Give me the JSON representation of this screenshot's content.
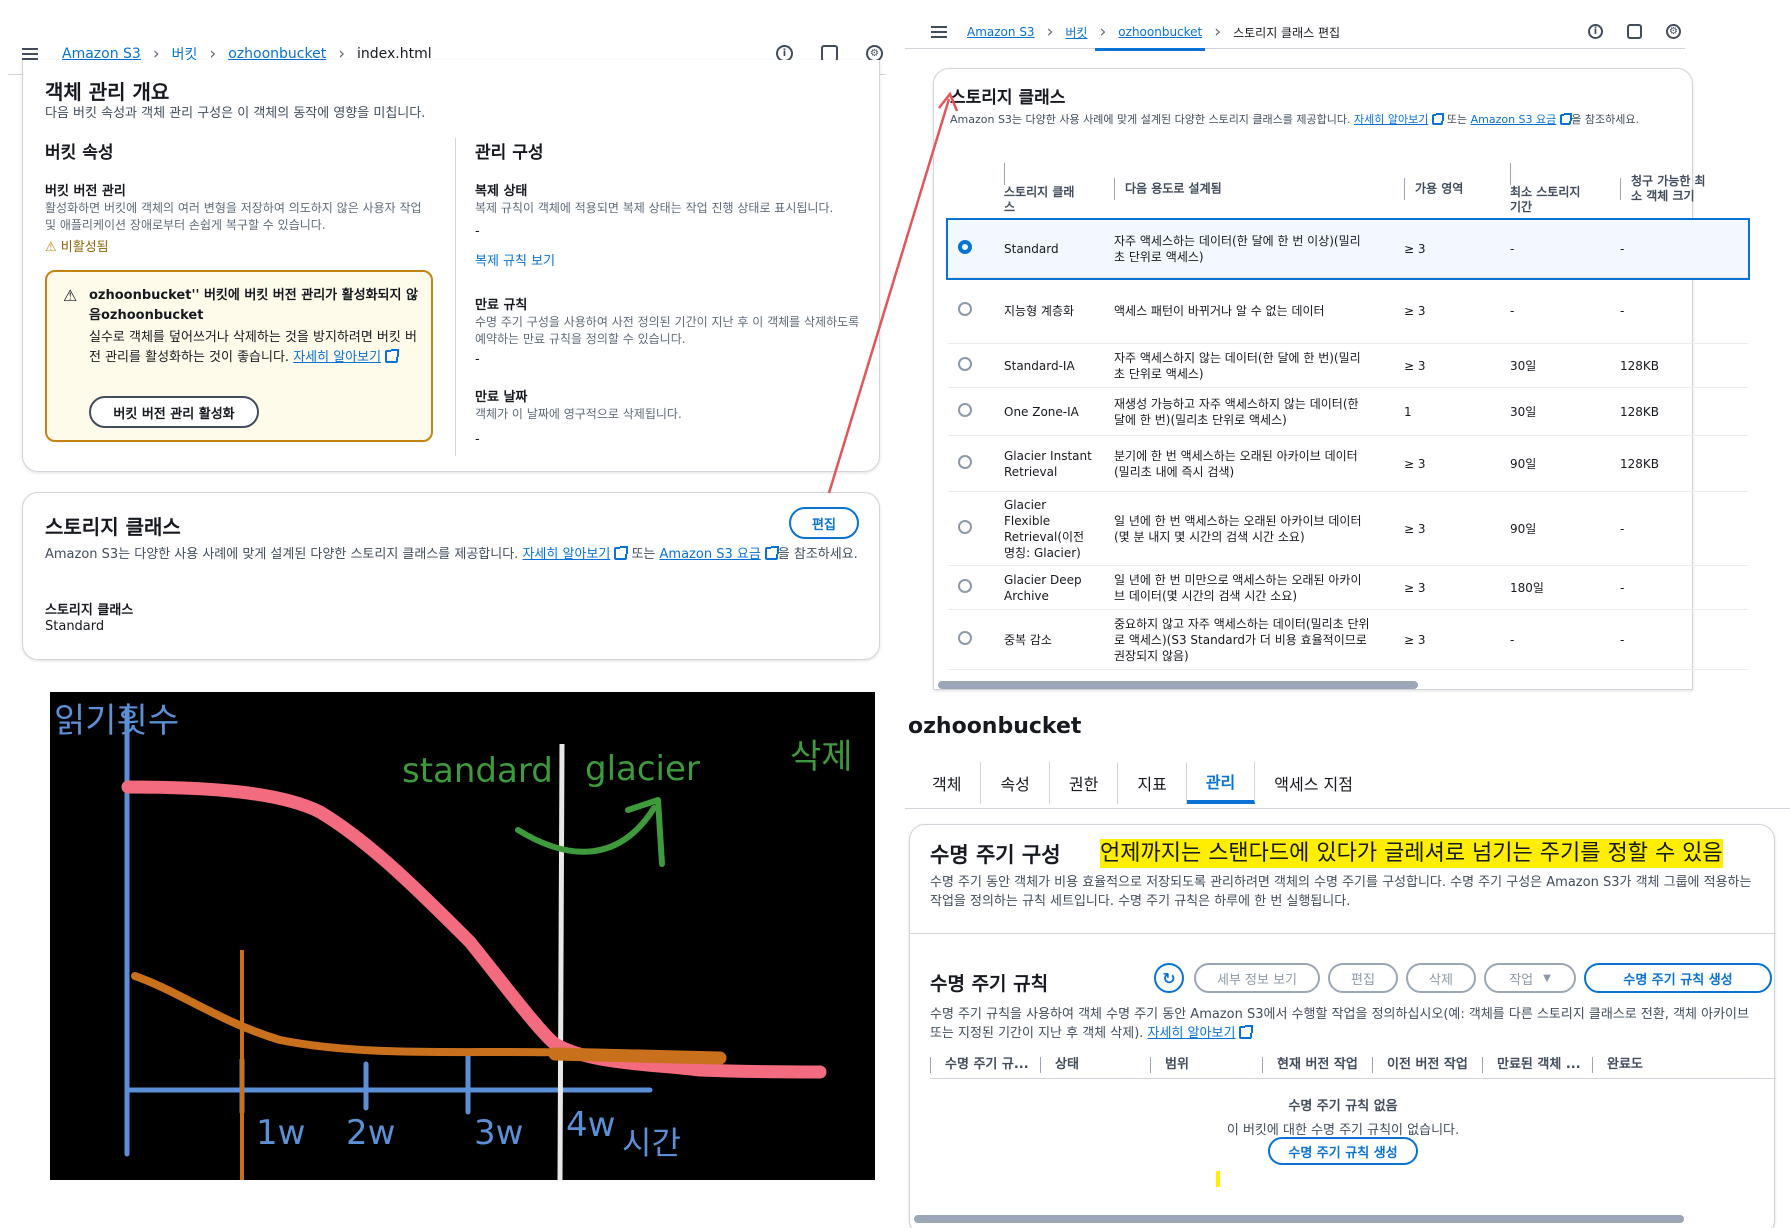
{
  "left_top": {
    "breadcrumb": [
      "Amazon S3",
      "버킷",
      "ozhoonbucket",
      "index.html"
    ],
    "overview": {
      "title": "객체 관리 개요",
      "desc": "다음 버킷 속성과 객체 관리 구성은 이 객체의 동작에 영향을 미칩니다."
    },
    "bucket_props": {
      "title": "버킷 속성",
      "versioning_title": "버킷 버전 관리",
      "versioning_desc": "활성화하면 버킷에 객체의 여러 변형을 저장하여 의도하지 않은 사용자 작업 및 애플리케이션 장애로부터 손쉽게 복구할 수 있습니다.",
      "versioning_status": "비활성됨"
    },
    "warning": {
      "title": "ozhoonbucket'' 버킷에 버킷 버전 관리가 활성화되지 않음ozhoonbucket",
      "body": "실수로 객체를 덮어쓰거나 삭제하는 것을 방지하려면 버킷 버전 관리를 활성화하는 것이 좋습니다.",
      "link": "자세히 알아보기",
      "button": "버킷 버전 관리 활성화"
    },
    "mgmt": {
      "title": "관리 구성",
      "repl_title": "복제 상태",
      "repl_desc": "복제 규칙이 객체에 적용되면 복제 상태는 작업 진행 상태로 표시됩니다.",
      "repl_value": "-",
      "repl_link": "복제 규칙 보기",
      "exp_rule_title": "만료 규칙",
      "exp_rule_desc": "수명 주기 구성을 사용하여 사전 정의된 기간이 지난 후 이 객체를 삭제하도록 예약하는 만료 규칙을 정의할 수 있습니다.",
      "exp_rule_value": "-",
      "exp_date_title": "만료 날짜",
      "exp_date_desc": "객체가 이 날짜에 영구적으로 삭제됩니다.",
      "exp_date_value": "-"
    },
    "storage": {
      "title": "스토리지 클래스",
      "edit": "편집",
      "desc_pre": "Amazon S3는 다양한 사용 사례에 맞게 설계된 다양한 스토리지 클래스를 제공합니다.",
      "link1": "자세히 알아보기",
      "mid": "또는",
      "link2": "Amazon S3 요금",
      "desc_post": "을 참조하세요.",
      "label": "스토리지 클래스",
      "value": "Standard"
    }
  },
  "right_top": {
    "breadcrumb": [
      "Amazon S3",
      "버킷",
      "ozhoonbucket",
      "스토리지 클래스 편집"
    ],
    "title": "스토리지 클래스",
    "desc_pre": "Amazon S3는 다양한 사용 사례에 맞게 설계된 다양한 스토리지 클래스를 제공합니다.",
    "link1": "자세히 알아보기",
    "mid": "또는",
    "link2": "Amazon S3 요금",
    "desc_post": "을 참조하세요.",
    "columns": [
      "스토리지 클래스",
      "다음 용도로 설계됨",
      "가용 영역",
      "최소 스토리지 기간",
      "청구 가능한 최소 객체 크기"
    ],
    "rows": [
      {
        "name": "Standard",
        "use": "자주 액세스하는 데이터(한 달에 한 번 이상)(밀리초 단위로 액세스)",
        "az": "≥ 3",
        "min": "-",
        "size": "-",
        "selected": true
      },
      {
        "name": "지능형 계층화",
        "use": "액세스 패턴이 바뀌거나 알 수 없는 데이터",
        "az": "≥ 3",
        "min": "-",
        "size": "-"
      },
      {
        "name": "Standard-IA",
        "use": "자주 액세스하지 않는 데이터(한 달에 한 번)(밀리초 단위로 액세스)",
        "az": "≥ 3",
        "min": "30일",
        "size": "128KB"
      },
      {
        "name": "One Zone-IA",
        "use": "재생성 가능하고 자주 액세스하지 않는 데이터(한 달에 한 번)(밀리초 단위로 액세스)",
        "az": "1",
        "min": "30일",
        "size": "128KB"
      },
      {
        "name": "Glacier Instant Retrieval",
        "use": "분기에 한 번 액세스하는 오래된 아카이브 데이터(밀리초 내에 즉시 검색)",
        "az": "≥ 3",
        "min": "90일",
        "size": "128KB"
      },
      {
        "name": "Glacier Flexible Retrieval(이전 명칭: Glacier)",
        "use": "일 년에 한 번 액세스하는 오래된 아카이브 데이터(몇 분 내지 몇 시간의 검색 시간 소요)",
        "az": "≥ 3",
        "min": "90일",
        "size": "-"
      },
      {
        "name": "Glacier Deep Archive",
        "use": "일 년에 한 번 미만으로 액세스하는 오래된 아카이브 데이터(몇 시간의 검색 시간 소요)",
        "az": "≥ 3",
        "min": "180일",
        "size": "-"
      },
      {
        "name": "중복 감소",
        "use": "중요하지 않고 자주 액세스하는 데이터(밀리초 단위로 액세스)(S3 Standard가 더 비용 효율적이므로 권장되지 않음)",
        "az": "≥ 3",
        "min": "-",
        "size": "-"
      }
    ]
  },
  "sketch": {
    "ylabel": "읽기횟수",
    "label_standard": "standard",
    "label_glacier": "glacier",
    "label_delete": "삭제",
    "ticks": [
      "1w",
      "2w",
      "3w",
      "4w"
    ],
    "xlabel": "시간"
  },
  "right_bottom": {
    "bucket": "ozhoonbucket",
    "tabs": [
      "객체",
      "속성",
      "권한",
      "지표",
      "관리",
      "액세스 지점"
    ],
    "active_tab": "관리",
    "lifecycle_title": "수명 주기 구성",
    "highlight": "언제까지는 스탠다드에 있다가 글레셔로 넘기는 주기를 정할 수 있음",
    "lifecycle_desc": "수명 주기 동안 객체가 비용 효율적으로 저장되도록 관리하려면 객체의 수명 주기를 구성합니다. 수명 주기 구성은 Amazon S3가 객체 그룹에 적용하는 작업을 정의하는 규칙 세트입니다. 수명 주기 규칙은 하루에 한 번 실행됩니다.",
    "rules_title": "수명 주기 규칙",
    "btn_details": "세부 정보 보기",
    "btn_edit": "편집",
    "btn_delete": "삭제",
    "btn_actions": "작업",
    "btn_create": "수명 주기 규칙 생성",
    "rules_desc": "수명 주기 규칙을 사용하여 객체 수명 주기 동안 Amazon S3에서 수행할 작업을 정의하십시오(예: 객체를 다른 스토리지 클래스로 전환, 객체 아카이브 또는 지정된 기간이 지난 후 객체 삭제).",
    "rules_link": "자세히 알아보기",
    "columns": [
      "수명 주기 규...",
      "상태",
      "범위",
      "현재 버전 작업",
      "이전 버전 작업",
      "만료된 객체 ...",
      "완료도"
    ],
    "empty_title": "수명 주기 규칙 없음",
    "empty_desc": "이 버킷에 대한 수명 주기 규칙이 없습니다.",
    "empty_btn": "수명 주기 규칙 생성"
  },
  "colors": {
    "link": "#0972d3",
    "warning": "#c58413",
    "sketch_bg": "#000000",
    "sketch_pink": "#f36b7f",
    "sketch_orange": "#c8701c",
    "sketch_blue": "#5b8fd6",
    "sketch_green": "#3e9a3c",
    "highlight": "#ffee00",
    "annotation_arrow": "#e0575b"
  }
}
